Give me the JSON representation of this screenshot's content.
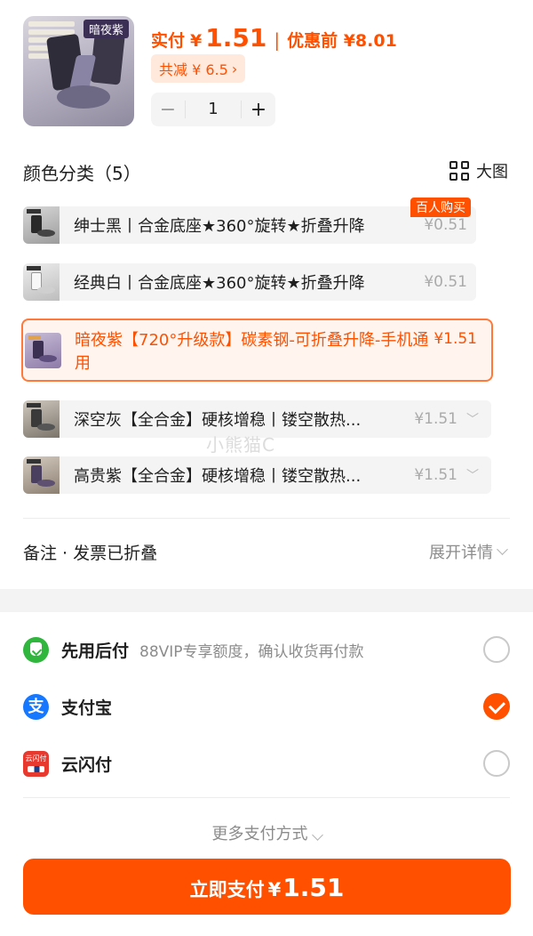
{
  "product": {
    "image_tag": "暗夜紫",
    "price_label": "实付",
    "currency": "¥",
    "price_value": "1.51",
    "original_label": "优惠前 ¥8.01",
    "discount_text": "共减 ¥ 6.5",
    "quantity": "1",
    "minus": "−",
    "plus": "+"
  },
  "variants_section": {
    "title": "颜色分类（5）",
    "big_view_label": "大图",
    "hot_badge": "百人购买",
    "items": [
      {
        "label": "绅士黑丨合金底座★360°旋转★折叠升降",
        "price": "¥0.51"
      },
      {
        "label": "经典白丨合金底座★360°旋转★折叠升降",
        "price": "¥0.51"
      },
      {
        "label": "暗夜紫【720°升级款】碳素钢-可折叠升降-手机通用",
        "price": "¥1.51"
      },
      {
        "label": "深空灰【全合金】硬核增稳丨镂空散热...",
        "price": "¥1.51"
      },
      {
        "label": "高贵紫【全合金】硬核增稳丨镂空散热...",
        "price": "¥1.51"
      }
    ]
  },
  "watermark": "小熊猫C",
  "remark": {
    "label": "备注 · 发票已折叠",
    "expand": "展开详情"
  },
  "payment": {
    "methods": [
      {
        "name": "先用后付",
        "sub": "88VIP专享额度，确认收货再付款",
        "icon": "credit-pay-icon",
        "selected": false
      },
      {
        "name": "支付宝",
        "sub": "",
        "icon": "alipay-icon",
        "selected": true
      },
      {
        "name": "云闪付",
        "sub": "",
        "icon": "unionpay-icon",
        "selected": false
      }
    ],
    "more": "更多支付方式",
    "alipay_glyph": "支",
    "union_glyph": "云闪付"
  },
  "pay_button": {
    "label": "立即支付",
    "currency": "¥",
    "amount": "1.51"
  },
  "colors": {
    "accent": "#ff5000",
    "alipay": "#1677ff",
    "green": "#2fb63d"
  }
}
